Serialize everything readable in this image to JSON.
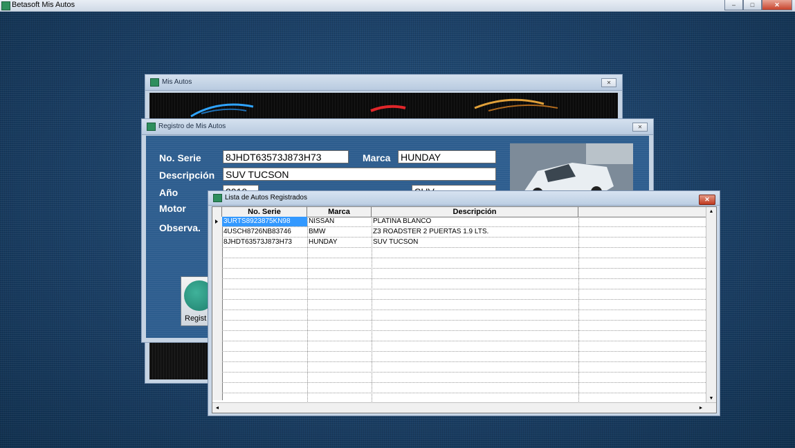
{
  "app": {
    "title": "Betasoft Mis Autos",
    "controls": {
      "minimize": "–",
      "maximize": "□",
      "close": "✕"
    }
  },
  "mis_autos_window": {
    "title": "Mis Autos",
    "close": "✕"
  },
  "registro_window": {
    "title": "Registro de Mis Autos",
    "close": "✕",
    "labels": {
      "serie": "No. Serie",
      "marca": "Marca",
      "descripcion": "Descripción",
      "anio": "Año",
      "motor": "Motor",
      "observa": "Observa."
    },
    "values": {
      "serie": "8JHDT63573J873H73",
      "marca": "HUNDAY",
      "descripcion": "SUV TUCSON",
      "anio": "2010",
      "tipo": "SUV"
    },
    "register_button": "Regist"
  },
  "lista_window": {
    "title": "Lista de Autos Registrados",
    "close": "✕",
    "columns": [
      "No. Serie",
      "Marca",
      "Descripción",
      ""
    ],
    "rows": [
      {
        "serie": "3URTS8923875KN98",
        "marca": "NISSAN",
        "descripcion": "PLATINA BLANCO"
      },
      {
        "serie": "4USCH8726NB83746",
        "marca": "BMW",
        "descripcion": "Z3 ROADSTER 2 PUERTAS 1.9 LTS."
      },
      {
        "serie": "8JHDT63573J873H73",
        "marca": "HUNDAY",
        "descripcion": "SUV TUCSON"
      }
    ],
    "scroll": {
      "up": "▲",
      "down": "▼",
      "left": "◄",
      "right": "►"
    }
  },
  "colors": {
    "desktop": "#1a3f66",
    "form_background": "#2d5d8e",
    "selection": "#3399ff"
  },
  "icons": [
    "app-car-icon",
    "close-icon",
    "minimize-icon",
    "maximize-icon",
    "register-car-icon",
    "row-pointer-icon"
  ]
}
